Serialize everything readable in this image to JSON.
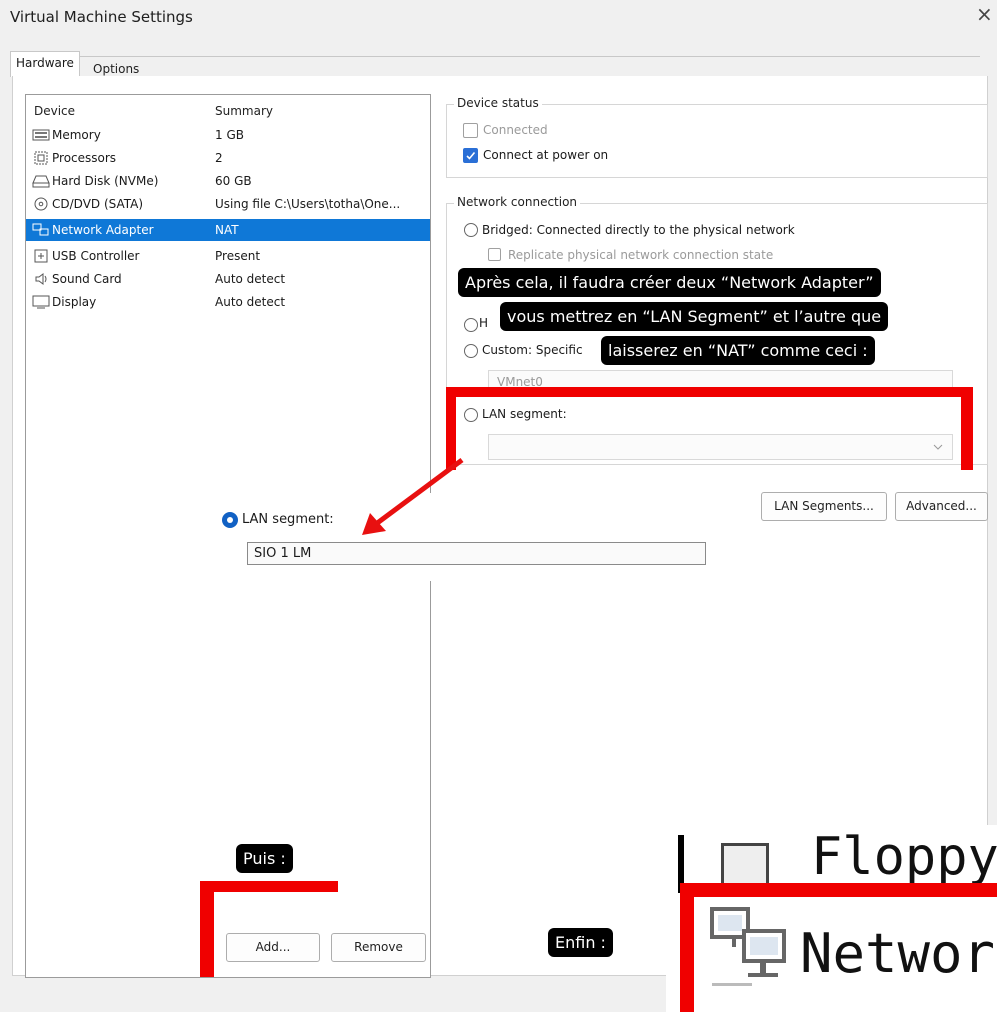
{
  "window": {
    "title": "Virtual Machine Settings",
    "close_glyph": "×"
  },
  "tabs": [
    {
      "label": "Hardware"
    },
    {
      "label": "Options"
    }
  ],
  "device_list": {
    "columns": {
      "device": "Device",
      "summary": "Summary"
    },
    "rows": [
      {
        "name": "Memory",
        "summary": "1 GB",
        "icon": "memory-icon"
      },
      {
        "name": "Processors",
        "summary": "2",
        "icon": "processor-icon"
      },
      {
        "name": "Hard Disk (NVMe)",
        "summary": "60 GB",
        "icon": "hard-disk-icon"
      },
      {
        "name": "CD/DVD (SATA)",
        "summary": "Using file C:\\Users\\totha\\One...",
        "icon": "cd-dvd-icon"
      },
      {
        "name": "Network Adapter",
        "summary": "NAT",
        "icon": "network-adapter-icon",
        "selected": true
      },
      {
        "name": "USB Controller",
        "summary": "Present",
        "icon": "usb-icon"
      },
      {
        "name": "Sound Card",
        "summary": "Auto detect",
        "icon": "sound-icon"
      },
      {
        "name": "Display",
        "summary": "Auto detect",
        "icon": "display-icon"
      }
    ],
    "add_label": "Add...",
    "remove_label": "Remove"
  },
  "device_status": {
    "title": "Device status",
    "connected_label": "Connected",
    "connected_checked": false,
    "power_on_label": "Connect at power on",
    "power_on_checked": true
  },
  "network": {
    "title": "Network connection",
    "bridged_label": "Bridged: Connected directly to the physical network",
    "replicate_label": "Replicate physical network connection state",
    "host_only_partial": "H",
    "custom_label": "Custom: Specific",
    "custom_combo_value": "VMnet0",
    "lan_label": "LAN segment:",
    "lan_segments_button": "LAN Segments...",
    "advanced_button": "Advanced..."
  },
  "zoom_inset": {
    "lan_label": "LAN segment:",
    "lan_value": "SIO 1 LM"
  },
  "annotations": {
    "line1": "Après cela, il faudra créer deux “Network Adapter”",
    "line2": "vous mettrez en “LAN Segment” et l’autre que",
    "line3": "laisserez en “NAT” comme ceci :",
    "puis": "Puis :",
    "enfin": "Enfin :"
  },
  "zoom_network": {
    "top_text": "Floppy",
    "label": "Network"
  },
  "colors": {
    "accent": "#0f78d7",
    "annotation_red": "#f00000",
    "checkbox_blue": "#2a6fd6"
  }
}
